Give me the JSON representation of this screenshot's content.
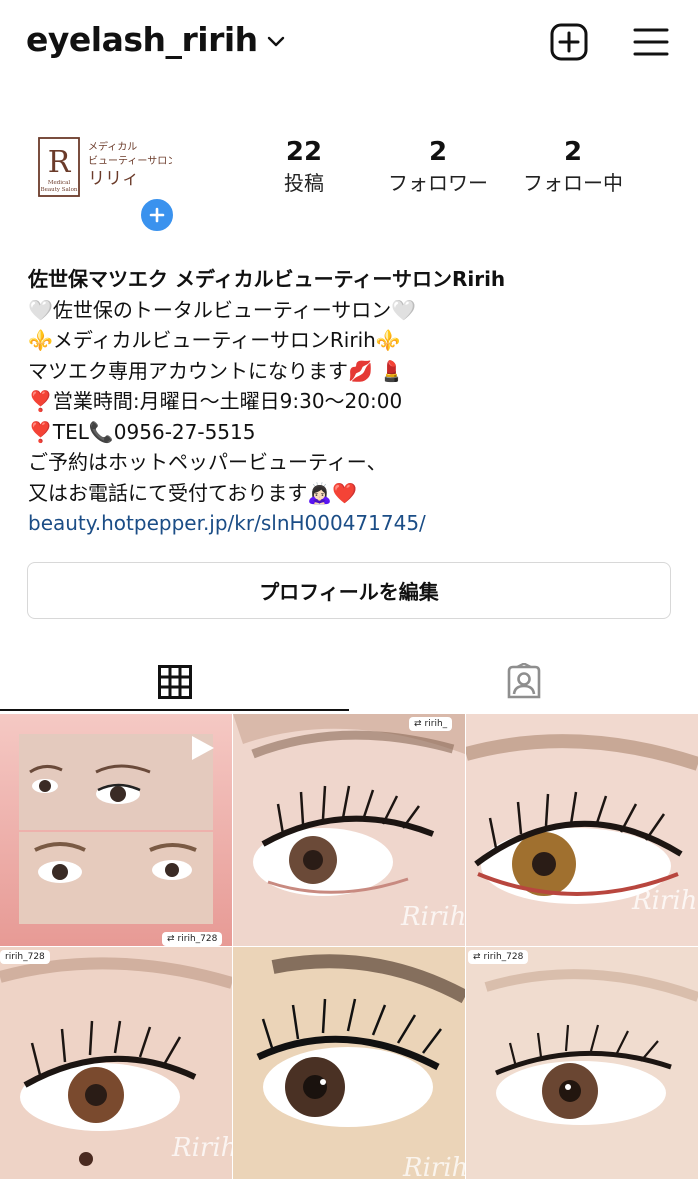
{
  "header": {
    "username": "eyelash_ririh",
    "chevron_icon": "chevron-down-icon",
    "create_icon": "plus-square-icon",
    "menu_icon": "hamburger-menu-icon"
  },
  "avatar": {
    "logo_letter": "R",
    "logo_line1": "メディカル",
    "logo_line2": "ビューティーサロン",
    "logo_line3": "リリィ",
    "logo_small1": "Medical",
    "logo_small2": "Beauty Salon",
    "add_icon": "plus-circle-icon"
  },
  "stats": [
    {
      "value": "22",
      "label": "投稿"
    },
    {
      "value": "2",
      "label": "フォロワー"
    },
    {
      "value": "2",
      "label": "フォロー中"
    }
  ],
  "bio": {
    "name": "佐世保マツエク メディカルビューティーサロンRirih",
    "lines": [
      "🤍佐世保のトータルビューティーサロン🤍",
      "⚜️メディカルビューティーサロンRirih⚜️",
      "マツエク専用アカウントになります💋 💄",
      "❣️営業時間:月曜日〜土曜日9:30〜20:00",
      "❣️TEL📞0956-27-5515",
      "ご予約はホットペッパービューティー、",
      "又はお電話にて受付ております🙇🏻‍♀️❤️"
    ],
    "link": "beauty.hotpepper.jp/kr/slnH000471745/"
  },
  "edit_profile_label": "プロフィールを編集",
  "tabs": [
    {
      "name": "grid-tab",
      "icon": "grid-icon",
      "active": true
    },
    {
      "name": "tagged-tab",
      "icon": "tagged-person-icon",
      "active": false
    }
  ],
  "posts": [
    {
      "tag": "ririh_728",
      "watermark": "",
      "video": true
    },
    {
      "tag": "ririh_",
      "watermark": "Ririh",
      "video": false
    },
    {
      "tag": "",
      "watermark": "Ririh",
      "video": false
    },
    {
      "tag": "ririh_728",
      "watermark": "Ririh",
      "video": false
    },
    {
      "tag": "",
      "watermark": "Ririh",
      "video": false
    },
    {
      "tag": "ririh_728",
      "watermark": "",
      "video": false
    }
  ],
  "colors": {
    "link": "#1b4d86",
    "accent_blue": "#3a92ee",
    "logo_brown": "#6b3b2a"
  }
}
